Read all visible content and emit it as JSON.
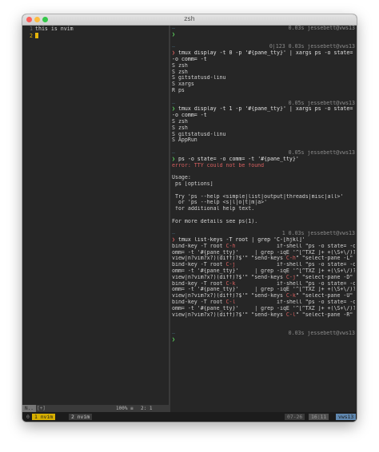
{
  "window": {
    "title": "zsh"
  },
  "editor": {
    "lines": [
      {
        "number": "1",
        "text": "this is nvim"
      },
      {
        "number": "2",
        "text": ""
      }
    ],
    "status": {
      "mode": "N..",
      "buffer": "[+]",
      "percent": "100% ≡",
      "position": "2:  1"
    }
  },
  "terminal": {
    "blocks": [
      {
        "info": "0.03s jessebett@vws13",
        "prompt": "❯",
        "prompt_state": "ok",
        "command": "",
        "output": []
      },
      {
        "info": "0|123 0.03s jessebett@vws13",
        "prompt": "❯",
        "prompt_state": "bad",
        "command": "tmux display -t 0 -p '#{pane_tty}' | xargs ps -o state= -o comm= -t",
        "output": [
          "S zsh",
          "S zsh",
          "S gitstatusd-linu",
          "S xargs",
          "R ps"
        ]
      },
      {
        "info": "0.05s jessebett@vws13",
        "prompt": "❯",
        "prompt_state": "ok",
        "command": "tmux display -t 1 -p '#{pane_tty}' | xargs ps -o state= -o comm= -t",
        "output": [
          "S zsh",
          "S zsh",
          "S gitstatusd-linu",
          "S AppRun"
        ]
      },
      {
        "info": "0.05s jessebett@vws13",
        "prompt": "❯",
        "prompt_state": "ok",
        "command": "ps -o state= -o comm= -t '#{pane_tty}'",
        "output": [
          "error: TTY could not be found",
          "",
          "Usage:",
          " ps [options]",
          "",
          " Try 'ps --help <simple|list|output|threads|misc|all>'",
          "  or 'ps --help <s|l|o|t|m|a>'",
          " for additional help text.",
          "",
          "For more details see ps(1)."
        ]
      },
      {
        "info": "1 0.03s jessebett@vws13",
        "prompt": "❯",
        "prompt_state": "bad",
        "command": "tmux list-keys -T root | grep 'C-[hjkl]'",
        "output": [],
        "bindings": [
          {
            "prefix": "bind-key -T root ",
            "key": "C-h",
            "rest": "             if-shell \"ps -o state= -o c"
          },
          {
            "prefix": "omm= -t '#{pane_tty}'     | grep -iqE '^[^TXZ ]+ +(\\S+\\/)?g?(",
            "key": "",
            "rest": ""
          },
          {
            "prefix": "view|n?vim?x?)(diff)?$'\" \"send-keys ",
            "key": "C-h",
            "rest": "\" \"select-pane -L\""
          },
          {
            "prefix": "bind-key -T root ",
            "key": "C-j",
            "rest": "             if-shell \"ps -o state= -o c"
          },
          {
            "prefix": "omm= -t '#{pane_tty}'     | grep -iqE '^[^TXZ ]+ +(\\S+\\/)?g?(",
            "key": "",
            "rest": ""
          },
          {
            "prefix": "view|n?vim?x?)(diff)?$'\" \"send-keys ",
            "key": "C-j",
            "rest": "\" \"select-pane -D\""
          },
          {
            "prefix": "bind-key -T root ",
            "key": "C-k",
            "rest": "             if-shell \"ps -o state= -o c"
          },
          {
            "prefix": "omm= -t '#{pane_tty}'     | grep -iqE '^[^TXZ ]+ +(\\S+\\/)?g?(",
            "key": "",
            "rest": ""
          },
          {
            "prefix": "view|n?vim?x?)(diff)?$'\" \"send-keys ",
            "key": "C-k",
            "rest": "\" \"select-pane -U\""
          },
          {
            "prefix": "bind-key -T root ",
            "key": "C-l",
            "rest": "             if-shell \"ps -o state= -o c"
          },
          {
            "prefix": "omm= -t '#{pane_tty}'     | grep -iqE '^[^TXZ ]+ +(\\S+\\/)?g?(",
            "key": "",
            "rest": ""
          },
          {
            "prefix": "view|n?vim?x?)(diff)?$'\" \"send-keys ",
            "key": "C-l",
            "rest": "\" \"select-pane -R\""
          }
        ]
      },
      {
        "info": "0.03s jessebett@vws13",
        "prompt": "❯",
        "prompt_state": "ok",
        "command": "",
        "output": []
      }
    ]
  },
  "tmux": {
    "windows": [
      {
        "label": "0",
        "state": "inactive"
      },
      {
        "label": "1 nvim",
        "state": "active"
      },
      {
        "label": "2 nvim",
        "state": "inactive"
      }
    ],
    "date": "07-26",
    "time": "16:11",
    "host": "vws13"
  },
  "colors": {
    "accent_yellow": "#d7af00",
    "prompt_ok": "#5fd75f",
    "prompt_bad": "#d75f5f",
    "host_blue": "#5f87af"
  }
}
